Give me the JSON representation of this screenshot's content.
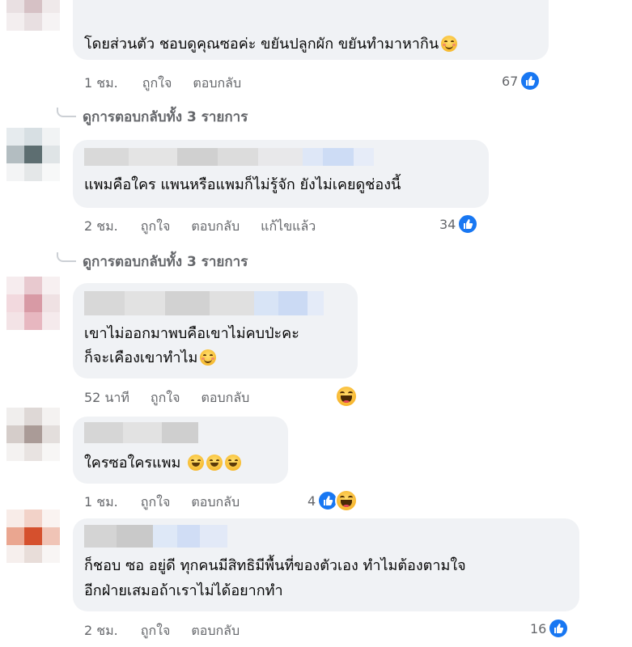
{
  "comments": [
    {
      "text_lines": [
        "โดยส่วนตัว ชอบดูคุณซอค่ะ ขยันปลูกผัก ขยันทำมาหากิน"
      ],
      "time": "1 ชม.",
      "like_label": "ถูกใจ",
      "reply_label": "ตอบกลับ",
      "edited_label": "",
      "reaction_count": "67",
      "view_replies": "ดูการตอบกลับทั้ง 3 รายการ"
    },
    {
      "text_lines": [
        "แพมคือใคร แพนหรือแพมก็ไม่รู้จัก ยังไม่เคยดูช่องนี้"
      ],
      "time": "2 ชม.",
      "like_label": "ถูกใจ",
      "reply_label": "ตอบกลับ",
      "edited_label": "แก้ไขแล้ว",
      "reaction_count": "34",
      "view_replies": "ดูการตอบกลับทั้ง 3 รายการ"
    },
    {
      "text_lines": [
        "เขาไม่ออกมาพบคือเขาไม่คบป่ะคะ",
        "ก็จะเคืองเขาทำไม"
      ],
      "time": "52 นาที",
      "like_label": "ถูกใจ",
      "reply_label": "ตอบกลับ",
      "edited_label": "",
      "reaction_count": "",
      "view_replies": ""
    },
    {
      "text_lines": [
        "ใครซอใครแพม"
      ],
      "time": "1 ชม.",
      "like_label": "ถูกใจ",
      "reply_label": "ตอบกลับ",
      "edited_label": "",
      "reaction_count": "4",
      "view_replies": ""
    },
    {
      "text_lines": [
        "ก็ชอบ ซอ อยู่ดี ทุกคนมีสิทธิมีพื้นที่ของตัวเอง ทำไมต้องตามใจ",
        "อีกฝ่ายเสมอถ้าเราไม่ได้อยากทำ"
      ],
      "time": "2 ชม.",
      "like_label": "ถูกใจ",
      "reply_label": "ตอบกลับ",
      "edited_label": "",
      "reaction_count": "16",
      "view_replies": ""
    }
  ],
  "colors": {
    "bubble": "#f0f2f5",
    "meta_text": "#65676b",
    "like_blue": "#1877f2"
  },
  "icons": [
    "like-icon",
    "haha-icon",
    "smile-emoji",
    "laugh-emoji",
    "blush-emoji"
  ]
}
